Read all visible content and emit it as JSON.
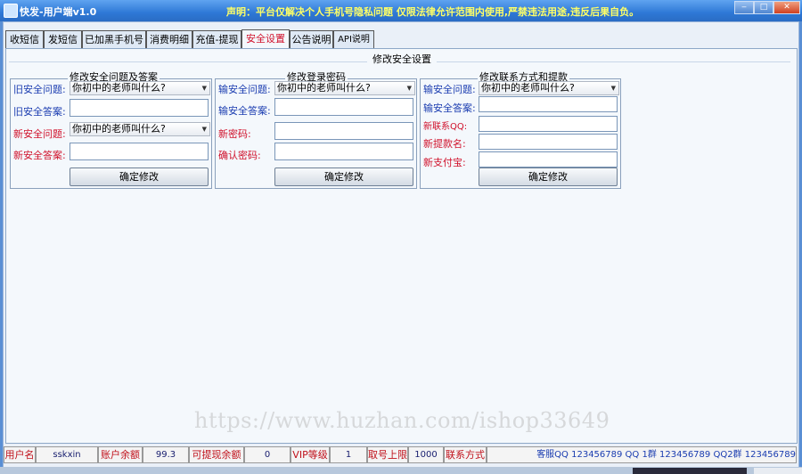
{
  "window": {
    "title": "快发-用户端v1.0",
    "notice": "声明：平台仅解决个人手机号隐私问题 仅限法律允许范围内使用,严禁违法用途,违反后果自负。",
    "controls": {
      "minimize": "‒",
      "maximize": "□",
      "close": "✕"
    }
  },
  "tabs": [
    {
      "label": "收短信"
    },
    {
      "label": "发短信"
    },
    {
      "label": "已加黑手机号"
    },
    {
      "label": "消费明细"
    },
    {
      "label": "充值-提现"
    },
    {
      "label": "安全设置"
    },
    {
      "label": "公告说明"
    },
    {
      "label": "API说明"
    }
  ],
  "section_title": "修改安全设置",
  "group1": {
    "title": "修改安全问题及答案",
    "old_question_label": "旧安全问题:",
    "old_question_value": "你初中的老师叫什么?",
    "old_answer_label": "旧安全答案:",
    "new_question_label": "新安全问题:",
    "new_question_value": "你初中的老师叫什么?",
    "new_answer_label": "新安全答案:",
    "confirm": "确定修改"
  },
  "group2": {
    "title": "修改登录密码",
    "question_label": "输安全问题:",
    "question_value": "你初中的老师叫什么?",
    "answer_label": "输安全答案:",
    "new_password_label": "新密码:",
    "confirm_password_label": "确认密码:",
    "confirm": "确定修改"
  },
  "group3": {
    "title": "修改联系方式和提款",
    "question_label": "输安全问题:",
    "question_value": "你初中的老师叫什么?",
    "answer_label": "输安全答案:",
    "new_qq_label": "新联系QQ:",
    "new_name_label": "新提款名:",
    "new_alipay_label": "新支付宝:",
    "confirm": "确定修改"
  },
  "watermark": "https://www.huzhan.com/ishop33649",
  "status": {
    "username_label": "用户名",
    "username": "sskxin",
    "balance_label": "账户余额",
    "balance": "99.3",
    "withdrawable_label": "可提现余额",
    "withdrawable": "0",
    "vip_label": "VIP等级",
    "vip": "1",
    "limit_label": "取号上限",
    "limit": "1000",
    "contact_label": "联系方式",
    "contact": "客服QQ  123456789 QQ 1群  123456789 QQ2群  123456789"
  },
  "colors": {
    "title_gradient": "#2e78d6",
    "label_blue": "#1a3cb0",
    "label_red": "#d0102a",
    "panel": "#f4f8fc"
  }
}
